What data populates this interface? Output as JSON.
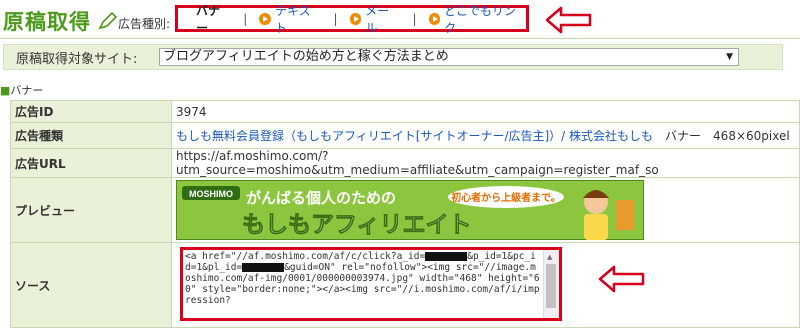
{
  "header": {
    "title": "原稿取得",
    "type_label": "広告種別:",
    "tabs": [
      {
        "label": "バナー"
      },
      {
        "label": "テキスト"
      },
      {
        "label": "メール"
      },
      {
        "label": "どこでもリンク"
      }
    ],
    "separator": "|"
  },
  "site_select": {
    "label": "原稿取得対象サイト:",
    "selected": "ブログアフィリエイトの始め方と稼ぐ方法まとめ"
  },
  "section": {
    "marker": "■",
    "title": "バナー"
  },
  "table": {
    "rows": [
      {
        "label": "広告ID",
        "value": "3974"
      },
      {
        "label": "広告種類",
        "link": "もしも無料会員登録（もしもアフィリエイト[サイトオーナー/広告主]）/ 株式会社もしも",
        "extra": "バナー　468×60pixel"
      },
      {
        "label": "広告URL",
        "value": "https://af.moshimo.com/?utm_source=moshimo&utm_medium=affiliate&utm_campaign=register_maf_so"
      },
      {
        "label": "プレビュー"
      },
      {
        "label": "ソース"
      }
    ]
  },
  "banner": {
    "logo": "MOSHIMO",
    "line1": "がんばる個人のための",
    "line2": "もしもアフィリエイト",
    "bubble": "初心者から上級者まで。"
  },
  "source": {
    "p1": "<a href=\"//af.moshimo.com/af/c/click?a_id=",
    "p2": "&p_id=1&pc_id=1&pl_id=",
    "p3": "&guid=ON\" rel=\"nofollow\"><img src=\"//image.moshimo.com/af-img/0001/000000003974.jpg\" width=\"468\" height=\"60\" style=\"border:none;\"></a><img src=\"//i.moshimo.com/af/i/impression?"
  },
  "colors": {
    "accent_green": "#4c9a1a",
    "highlight_red": "#d6001c",
    "link_blue": "#1a5ab8"
  }
}
